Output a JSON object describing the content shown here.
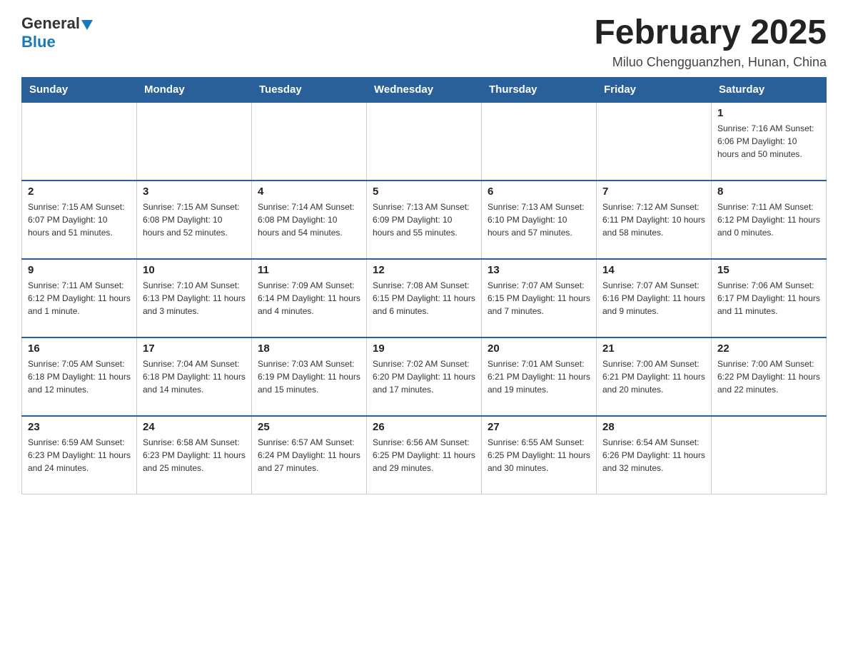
{
  "header": {
    "logo": {
      "general": "General",
      "blue": "Blue"
    },
    "title": "February 2025",
    "location": "Miluo Chengguanzhen, Hunan, China"
  },
  "weekdays": [
    "Sunday",
    "Monday",
    "Tuesday",
    "Wednesday",
    "Thursday",
    "Friday",
    "Saturday"
  ],
  "weeks": [
    [
      {
        "day": "",
        "info": ""
      },
      {
        "day": "",
        "info": ""
      },
      {
        "day": "",
        "info": ""
      },
      {
        "day": "",
        "info": ""
      },
      {
        "day": "",
        "info": ""
      },
      {
        "day": "",
        "info": ""
      },
      {
        "day": "1",
        "info": "Sunrise: 7:16 AM\nSunset: 6:06 PM\nDaylight: 10 hours and 50 minutes."
      }
    ],
    [
      {
        "day": "2",
        "info": "Sunrise: 7:15 AM\nSunset: 6:07 PM\nDaylight: 10 hours and 51 minutes."
      },
      {
        "day": "3",
        "info": "Sunrise: 7:15 AM\nSunset: 6:08 PM\nDaylight: 10 hours and 52 minutes."
      },
      {
        "day": "4",
        "info": "Sunrise: 7:14 AM\nSunset: 6:08 PM\nDaylight: 10 hours and 54 minutes."
      },
      {
        "day": "5",
        "info": "Sunrise: 7:13 AM\nSunset: 6:09 PM\nDaylight: 10 hours and 55 minutes."
      },
      {
        "day": "6",
        "info": "Sunrise: 7:13 AM\nSunset: 6:10 PM\nDaylight: 10 hours and 57 minutes."
      },
      {
        "day": "7",
        "info": "Sunrise: 7:12 AM\nSunset: 6:11 PM\nDaylight: 10 hours and 58 minutes."
      },
      {
        "day": "8",
        "info": "Sunrise: 7:11 AM\nSunset: 6:12 PM\nDaylight: 11 hours and 0 minutes."
      }
    ],
    [
      {
        "day": "9",
        "info": "Sunrise: 7:11 AM\nSunset: 6:12 PM\nDaylight: 11 hours and 1 minute."
      },
      {
        "day": "10",
        "info": "Sunrise: 7:10 AM\nSunset: 6:13 PM\nDaylight: 11 hours and 3 minutes."
      },
      {
        "day": "11",
        "info": "Sunrise: 7:09 AM\nSunset: 6:14 PM\nDaylight: 11 hours and 4 minutes."
      },
      {
        "day": "12",
        "info": "Sunrise: 7:08 AM\nSunset: 6:15 PM\nDaylight: 11 hours and 6 minutes."
      },
      {
        "day": "13",
        "info": "Sunrise: 7:07 AM\nSunset: 6:15 PM\nDaylight: 11 hours and 7 minutes."
      },
      {
        "day": "14",
        "info": "Sunrise: 7:07 AM\nSunset: 6:16 PM\nDaylight: 11 hours and 9 minutes."
      },
      {
        "day": "15",
        "info": "Sunrise: 7:06 AM\nSunset: 6:17 PM\nDaylight: 11 hours and 11 minutes."
      }
    ],
    [
      {
        "day": "16",
        "info": "Sunrise: 7:05 AM\nSunset: 6:18 PM\nDaylight: 11 hours and 12 minutes."
      },
      {
        "day": "17",
        "info": "Sunrise: 7:04 AM\nSunset: 6:18 PM\nDaylight: 11 hours and 14 minutes."
      },
      {
        "day": "18",
        "info": "Sunrise: 7:03 AM\nSunset: 6:19 PM\nDaylight: 11 hours and 15 minutes."
      },
      {
        "day": "19",
        "info": "Sunrise: 7:02 AM\nSunset: 6:20 PM\nDaylight: 11 hours and 17 minutes."
      },
      {
        "day": "20",
        "info": "Sunrise: 7:01 AM\nSunset: 6:21 PM\nDaylight: 11 hours and 19 minutes."
      },
      {
        "day": "21",
        "info": "Sunrise: 7:00 AM\nSunset: 6:21 PM\nDaylight: 11 hours and 20 minutes."
      },
      {
        "day": "22",
        "info": "Sunrise: 7:00 AM\nSunset: 6:22 PM\nDaylight: 11 hours and 22 minutes."
      }
    ],
    [
      {
        "day": "23",
        "info": "Sunrise: 6:59 AM\nSunset: 6:23 PM\nDaylight: 11 hours and 24 minutes."
      },
      {
        "day": "24",
        "info": "Sunrise: 6:58 AM\nSunset: 6:23 PM\nDaylight: 11 hours and 25 minutes."
      },
      {
        "day": "25",
        "info": "Sunrise: 6:57 AM\nSunset: 6:24 PM\nDaylight: 11 hours and 27 minutes."
      },
      {
        "day": "26",
        "info": "Sunrise: 6:56 AM\nSunset: 6:25 PM\nDaylight: 11 hours and 29 minutes."
      },
      {
        "day": "27",
        "info": "Sunrise: 6:55 AM\nSunset: 6:25 PM\nDaylight: 11 hours and 30 minutes."
      },
      {
        "day": "28",
        "info": "Sunrise: 6:54 AM\nSunset: 6:26 PM\nDaylight: 11 hours and 32 minutes."
      },
      {
        "day": "",
        "info": ""
      }
    ]
  ],
  "colors": {
    "header_bg": "#2a6099",
    "header_text": "#ffffff",
    "border": "#cccccc"
  }
}
